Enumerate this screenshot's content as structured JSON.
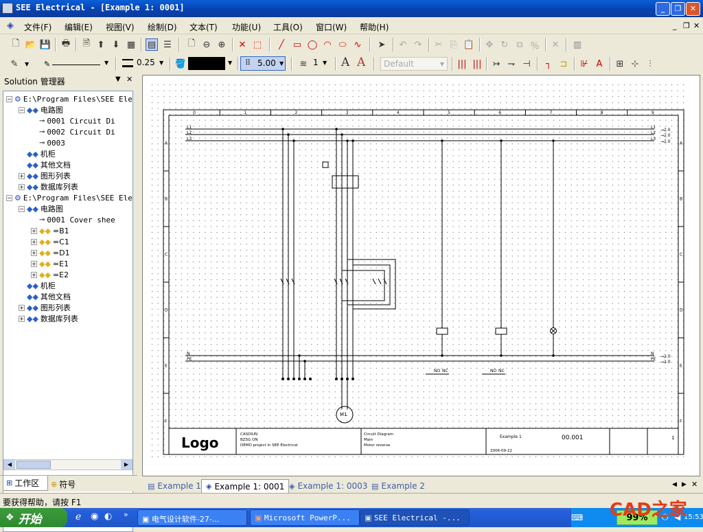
{
  "window": {
    "title": "SEE Electrical - [Example 1: 0001]"
  },
  "menu": [
    "文件(F)",
    "编辑(E)",
    "视图(V)",
    "绘制(D)",
    "文本(T)",
    "功能(U)",
    "工具(O)",
    "窗口(W)",
    "帮助(H)"
  ],
  "toolbar2": {
    "line_width": "0.25",
    "color_label": "",
    "grid_size": "5.00",
    "layer": "1",
    "style_placeholder": "Default"
  },
  "panel": {
    "title": "Solution 管理器",
    "tree": [
      {
        "label": "E:\\Program Files\\SEE Ele",
        "level": 0,
        "type": "project"
      },
      {
        "label": "电路图",
        "level": 1,
        "type": "folder"
      },
      {
        "label": "0001   Circuit Di",
        "level": 2,
        "type": "page"
      },
      {
        "label": "0002   Circuit Di",
        "level": 2,
        "type": "page"
      },
      {
        "label": "0003",
        "level": 2,
        "type": "page"
      },
      {
        "label": "机柜",
        "level": 1,
        "type": "folder"
      },
      {
        "label": "其他文档",
        "level": 1,
        "type": "folder"
      },
      {
        "label": "图形列表",
        "level": 1,
        "type": "folder"
      },
      {
        "label": "数据库列表",
        "level": 1,
        "type": "folder"
      },
      {
        "label": "E:\\Program Files\\SEE Ele",
        "level": 0,
        "type": "project"
      },
      {
        "label": "电路图",
        "level": 1,
        "type": "folder"
      },
      {
        "label": "0001   Cover shee",
        "level": 2,
        "type": "page"
      },
      {
        "label": "=B1",
        "level": 2,
        "type": "group"
      },
      {
        "label": "=C1",
        "level": 2,
        "type": "group"
      },
      {
        "label": "=D1",
        "level": 2,
        "type": "group"
      },
      {
        "label": "=E1",
        "level": 2,
        "type": "group"
      },
      {
        "label": "=E2",
        "level": 2,
        "type": "group"
      },
      {
        "label": "机柜",
        "level": 1,
        "type": "folder"
      },
      {
        "label": "其他文档",
        "level": 1,
        "type": "folder"
      },
      {
        "label": "图形列表",
        "level": 1,
        "type": "folder"
      },
      {
        "label": "数据库列表",
        "level": 1,
        "type": "folder"
      }
    ],
    "tabs": [
      "工作区",
      "符号"
    ]
  },
  "drawing": {
    "columns": [
      "0",
      "1",
      "2",
      "3",
      "4",
      "5",
      "6",
      "7",
      "8",
      "9"
    ],
    "rows": [
      "A",
      "B",
      "C",
      "D",
      "E",
      "F"
    ],
    "buses_left": [
      "L1",
      "L2",
      "L3",
      "N",
      "PE"
    ],
    "bus_targets": [
      "2.0",
      "2.0",
      "2.0",
      "2.0",
      "2.0"
    ],
    "title_block": {
      "logo": "Logo",
      "company": [
        "CASDIUN",
        "BZSG ON",
        "DEMO project in SEE Electrical"
      ],
      "description": [
        "Circuit Diagram",
        "Main",
        "Motor reverse"
      ],
      "date": "2006-09-22",
      "project": "Example 1",
      "page": "00.001",
      "sheet_total": "1"
    },
    "motor_label": "M1",
    "contact_labels": [
      "NO",
      "NC"
    ]
  },
  "doc_tabs": [
    "Example 1",
    "Example 1: 0001",
    "Example 1: 0003",
    "Example 2"
  ],
  "status": {
    "text": "要获得帮助，请按 F1"
  },
  "taskbar": {
    "start": "开始",
    "tasks": [
      "电气设计软件-27-...",
      "Microsoft PowerP...",
      "SEE Electrical -..."
    ],
    "battery": "99%",
    "time": "15:53"
  },
  "watermark": "CAD之家"
}
